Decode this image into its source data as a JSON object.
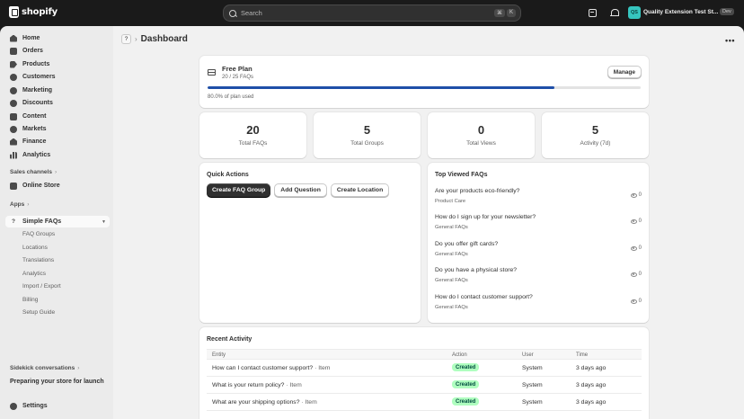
{
  "topbar": {
    "logo_text": "shopify",
    "search_placeholder": "Search",
    "shortcut_keys": [
      "⌘",
      "K"
    ],
    "store_initials": "QS",
    "store_name": "Quality Extension Test St...",
    "dev_badge": "Dev"
  },
  "sidebar": {
    "items": [
      {
        "label": "Home",
        "icon": "home-icon"
      },
      {
        "label": "Orders",
        "icon": "orders-icon"
      },
      {
        "label": "Products",
        "icon": "products-icon"
      },
      {
        "label": "Customers",
        "icon": "customers-icon"
      },
      {
        "label": "Marketing",
        "icon": "marketing-icon"
      },
      {
        "label": "Discounts",
        "icon": "discounts-icon"
      },
      {
        "label": "Content",
        "icon": "content-icon"
      },
      {
        "label": "Markets",
        "icon": "markets-icon"
      },
      {
        "label": "Finance",
        "icon": "finance-icon"
      },
      {
        "label": "Analytics",
        "icon": "analytics-icon"
      }
    ],
    "sales_channels_label": "Sales channels",
    "online_store_label": "Online Store",
    "apps_label": "Apps",
    "app_name": "Simple FAQs",
    "app_subitems": [
      "FAQ Groups",
      "Locations",
      "Translations",
      "Analytics",
      "Import / Export",
      "Billing",
      "Setup Guide"
    ],
    "sidekick_label": "Sidekick conversations",
    "sidekick_item": "Preparing your store for launch",
    "settings_label": "Settings"
  },
  "header": {
    "help": "?",
    "title": "Dashboard"
  },
  "plan": {
    "name": "Free Plan",
    "count": "20 / 25 FAQs",
    "manage_label": "Manage",
    "used_text": "80.0% of plan used",
    "used_fraction": 0.8
  },
  "stats": [
    {
      "value": "20",
      "label": "Total FAQs"
    },
    {
      "value": "5",
      "label": "Total Groups"
    },
    {
      "value": "0",
      "label": "Total Views"
    },
    {
      "value": "5",
      "label": "Activity (7d)"
    }
  ],
  "quick_actions": {
    "title": "Quick Actions",
    "create_group": "Create FAQ Group",
    "add_question": "Add Question",
    "create_location": "Create Location"
  },
  "top_viewed": {
    "title": "Top Viewed FAQs",
    "items": [
      {
        "question": "Are your products eco-friendly?",
        "group": "Product Care",
        "views": "0"
      },
      {
        "question": "How do I sign up for your newsletter?",
        "group": "General FAQs",
        "views": "0"
      },
      {
        "question": "Do you offer gift cards?",
        "group": "General FAQs",
        "views": "0"
      },
      {
        "question": "Do you have a physical store?",
        "group": "General FAQs",
        "views": "0"
      },
      {
        "question": "How do I contact customer support?",
        "group": "General FAQs",
        "views": "0"
      }
    ]
  },
  "recent_activity": {
    "title": "Recent Activity",
    "columns": [
      "Entity",
      "Action",
      "User",
      "Time"
    ],
    "rows": [
      {
        "entity": "How can I contact customer support?",
        "suffix": "· Item",
        "action": "Created",
        "user": "System",
        "time": "3 days ago"
      },
      {
        "entity": "What is your return policy?",
        "suffix": "· Item",
        "action": "Created",
        "user": "System",
        "time": "3 days ago"
      },
      {
        "entity": "What are your shipping options?",
        "suffix": "· Item",
        "action": "Created",
        "user": "System",
        "time": "3 days ago"
      }
    ]
  },
  "colors": {
    "progress": "#1f4fa8",
    "badge_bg": "#affebf",
    "store_badge": "#36c5bf"
  }
}
